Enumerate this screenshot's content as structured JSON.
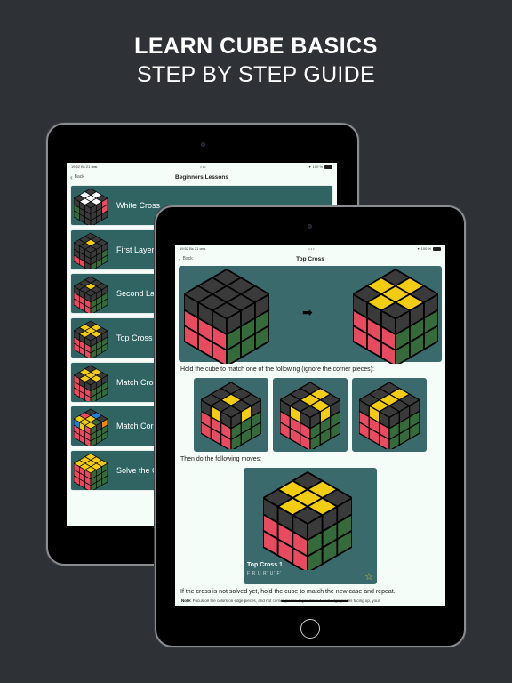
{
  "headline": {
    "line1": "LEARN CUBE BASICS",
    "line2": "STEP BY STEP GUIDE"
  },
  "colors": {
    "background": "#2e3236",
    "card": "#2f6463",
    "screen": "#f5fdf8",
    "sticker_black": "#3a3a3a",
    "sticker_yellow": "#f2cc0e",
    "sticker_red": "#e84a5f",
    "sticker_green": "#356b3a",
    "sticker_white": "#ffffff",
    "sticker_blue": "#1e7fe0",
    "sticker_orange": "#f08a10",
    "star": "#d9c23a"
  },
  "back_device": {
    "status": {
      "time": "19:52",
      "date": "Вс 21 янв.",
      "dots": "•••",
      "battery": "100 %"
    },
    "nav": {
      "back_label": "Back",
      "title": "Beginners Lessons"
    },
    "lessons": [
      {
        "label": "White Cross",
        "icon": "cube-white-cross-icon"
      },
      {
        "label": "First Layer",
        "icon": "cube-first-layer-icon"
      },
      {
        "label": "Second Layer",
        "icon": "cube-second-layer-icon"
      },
      {
        "label": "Top Cross",
        "icon": "cube-top-cross-icon"
      },
      {
        "label": "Match Cross",
        "icon": "cube-match-cross-icon"
      },
      {
        "label": "Match Corners",
        "icon": "cube-match-corners-icon"
      },
      {
        "label": "Solve the Cube",
        "icon": "cube-solved-icon"
      }
    ]
  },
  "front_device": {
    "status": {
      "time": "19:52",
      "date": "Вс 21 янв.",
      "dots": "•••",
      "battery": "100 %"
    },
    "nav": {
      "back_label": "Back",
      "title": "Top Cross"
    },
    "hold_text": "Hold the cube to match one of the following (ignore the corner pieces):",
    "then_text": "Then do the following moves:",
    "algorithm": {
      "name": "Top Cross 1",
      "moves": "F R U R' U' F'",
      "favorite_icon": "star-outline-icon"
    },
    "repeat_text": "If the cross is not solved yet, hold the cube to match the new case and repeat.",
    "note_label": "Note:",
    "note_text": "Focus on the colors on edge pieces, and not corner pieces. If you have 1 or 3 edge pieces facing up, your"
  }
}
